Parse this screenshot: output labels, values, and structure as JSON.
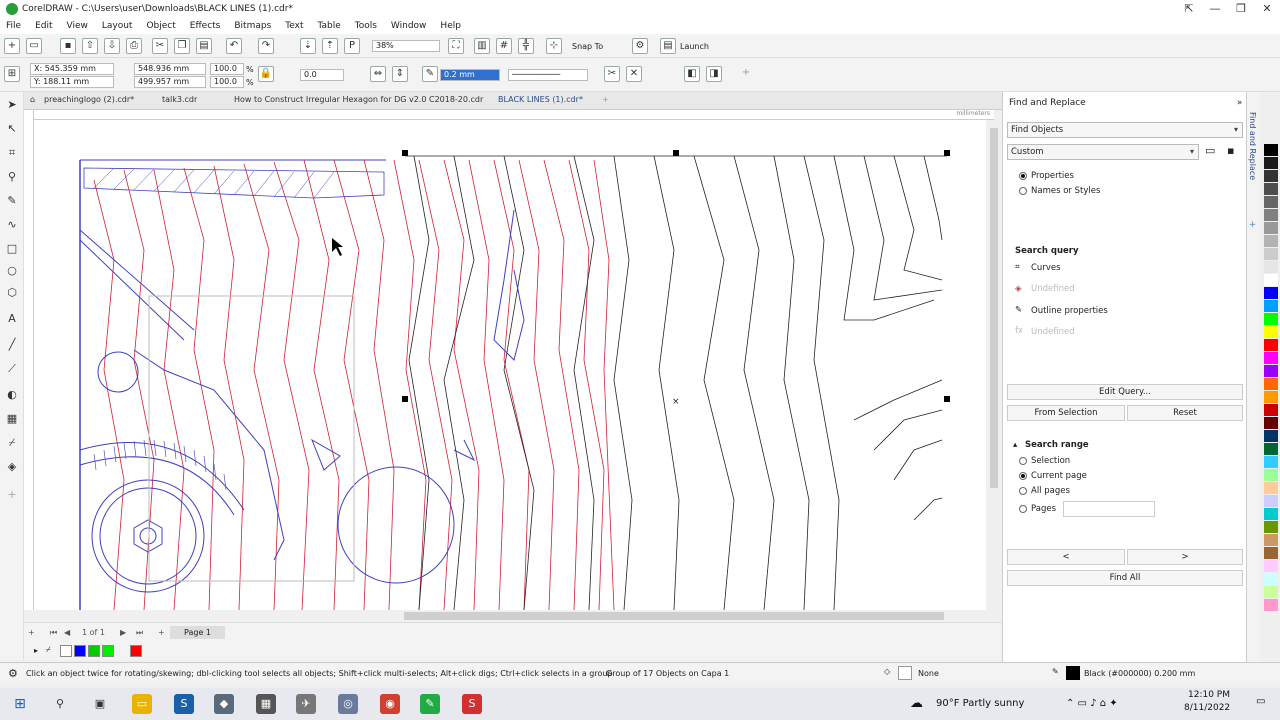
{
  "window": {
    "title": "CorelDRAW - C:\\Users\\user\\Downloads\\BLACK LINES (1).cdr*"
  },
  "menu": [
    "File",
    "Edit",
    "View",
    "Layout",
    "Object",
    "Effects",
    "Bitmaps",
    "Text",
    "Table",
    "Tools",
    "Window",
    "Help"
  ],
  "toolbar": {
    "zoom": "38%",
    "snap_to": "Snap To",
    "launch": "Launch"
  },
  "properties": {
    "x": "X: 545.359 mm",
    "y": "Y: 188.11 mm",
    "width": "548.936 mm",
    "height": "499.957 mm",
    "scale_w": "100.0",
    "scale_h": "100.0",
    "percent": "%",
    "angle": "0.0",
    "outline_width": "0.2 mm"
  },
  "tabs": [
    "preachinglogo (2).cdr*",
    "talk3.cdr",
    "How to Construct Irregular Hexagon for DG v2.0 C2018-20.cdr",
    "BLACK LINES (1).cdr*"
  ],
  "ruler_unit": "millimeters",
  "pagenav": {
    "count": "1 of 1",
    "page": "Page 1"
  },
  "status": {
    "hint": "Click an object twice for rotating/skewing; dbl-clicking tool selects all objects; Shift+click multi-selects; Alt+click digs; Ctrl+click selects in a group",
    "selection": "Group of 17 Objects on Capa 1",
    "fill": "None",
    "outline": "Black (#000000)  0.200 mm"
  },
  "docker": {
    "title": "Find and Replace",
    "mode": "Find Objects",
    "preset": "Custom",
    "radio1": "Properties",
    "radio2": "Names or Styles",
    "search_query": "Search query",
    "q_curves": "Curves",
    "q_undefined1": "Undefined",
    "q_outline": "Outline properties",
    "q_undefined2": "Undefined",
    "edit_query": "Edit Query...",
    "from_selection": "From Selection",
    "reset": "Reset",
    "search_range": "Search range",
    "r_selection": "Selection",
    "r_current": "Current page",
    "r_all": "All pages",
    "r_pages": "Pages",
    "prev": "<",
    "next": ">",
    "find_all": "Find All",
    "side_label": "Find and Replace"
  },
  "taskbar": {
    "weather": "90°F  Partly sunny",
    "time": "12:10 PM",
    "date": "8/11/2022"
  },
  "palette_colors": [
    "#000000",
    "#1a1a1a",
    "#333333",
    "#4d4d4d",
    "#666666",
    "#808080",
    "#999999",
    "#b3b3b3",
    "#cccccc",
    "#e6e6e6",
    "#ffffff",
    "#0000ff",
    "#00a0ff",
    "#00ff00",
    "#ffff00",
    "#ff0000",
    "#ff00ff",
    "#9900ff",
    "#ff6600",
    "#ff9900",
    "#cc0000",
    "#660000",
    "#003366",
    "#006633",
    "#33ccff",
    "#99ff99",
    "#ffcc99",
    "#ccccff",
    "#00cccc",
    "#669900",
    "#cc9966",
    "#996633",
    "#ffccff",
    "#ccffff",
    "#ccff99",
    "#ff99cc"
  ],
  "bottom_swatches": [
    "#0000ff",
    "#00cc00",
    "#00ee00",
    "#ff0000"
  ]
}
